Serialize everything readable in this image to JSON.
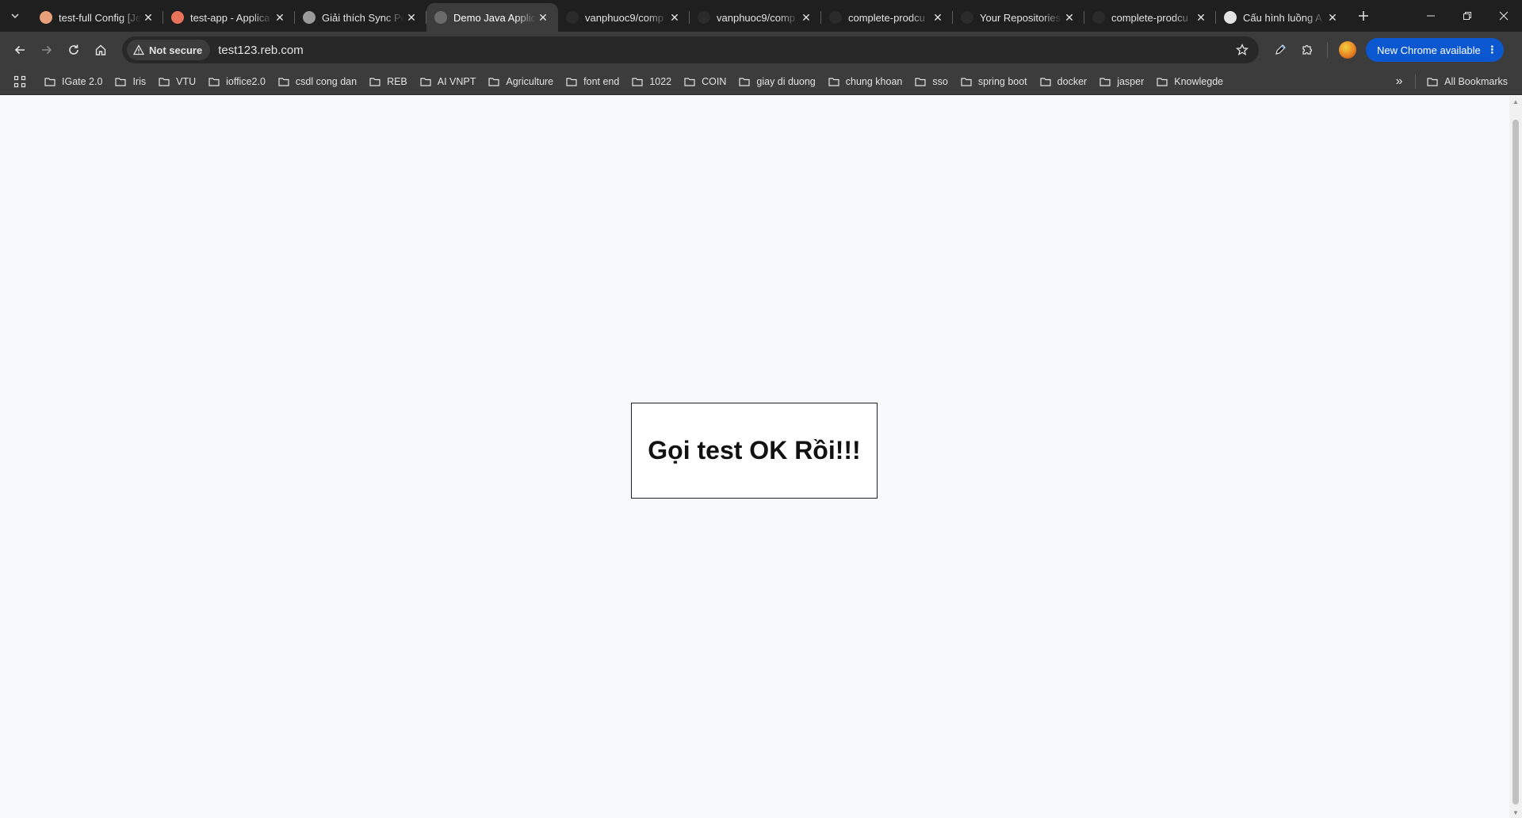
{
  "tabs": [
    {
      "title": "test-full Config [Je",
      "favicon_color": "#e8a07a",
      "active": false
    },
    {
      "title": "test-app - Applica",
      "favicon_color": "#e8735a",
      "active": false
    },
    {
      "title": "Giải thích Sync Po",
      "favicon_color": "#9a9a9a",
      "active": false
    },
    {
      "title": "Demo Java Applic",
      "favicon_color": "#6b6b6b",
      "active": true
    },
    {
      "title": "vanphuoc9/comp",
      "favicon_color": "#2b2b2b",
      "active": false
    },
    {
      "title": "vanphuoc9/comp",
      "favicon_color": "#2b2b2b",
      "active": false
    },
    {
      "title": "complete-prodcu",
      "favicon_color": "#2b2b2b",
      "active": false
    },
    {
      "title": "Your Repositories",
      "favicon_color": "#2b2b2b",
      "active": false
    },
    {
      "title": "complete-prodcu",
      "favicon_color": "#2b2b2b",
      "active": false
    },
    {
      "title": "Cấu hình luồng A",
      "favicon_color": "#e3e3e3",
      "active": false
    }
  ],
  "toolbar": {
    "security_label": "Not secure",
    "url": "test123.reb.com",
    "update_label": "New Chrome available"
  },
  "bookmarks": [
    "IGate 2.0",
    "Iris",
    "VTU",
    "ioffice2.0",
    "csdl cong dan",
    "REB",
    "AI VNPT",
    "Agriculture",
    "font end",
    "1022",
    "COIN",
    "giay di duong",
    "chung khoan",
    "sso",
    "spring boot",
    "docker",
    "jasper",
    "Knowlegde"
  ],
  "all_bookmarks_label": "All Bookmarks",
  "page": {
    "message": "Gọi test OK Rồi!!!"
  }
}
